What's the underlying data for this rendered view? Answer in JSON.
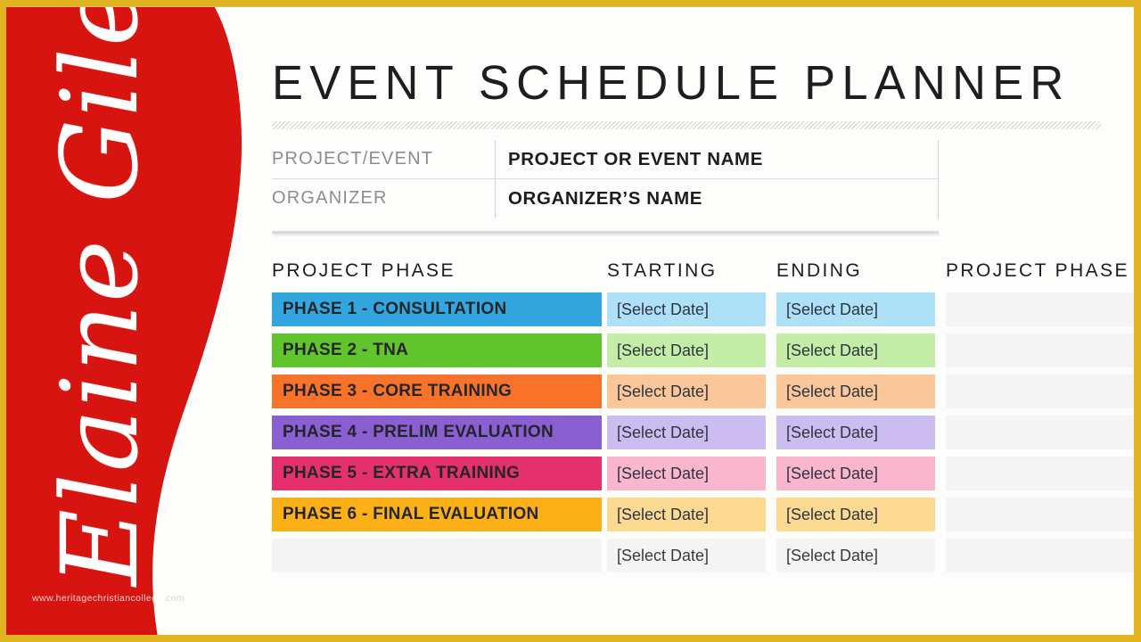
{
  "slide": {
    "title": "EVENT SCHEDULE PLANNER",
    "frame_color": "#e0b420",
    "background": "#fdfdfb"
  },
  "sidebar": {
    "shape_color": "#d81410",
    "signature": "Elaine Giles",
    "watermark": "www.heritagechristiancollege",
    "watermark_tail": ".com"
  },
  "info": {
    "rows": [
      {
        "label": "PROJECT/EVENT",
        "value": "PROJECT OR EVENT NAME"
      },
      {
        "label": "ORGANIZER",
        "value": "ORGANIZER’S NAME"
      }
    ]
  },
  "schedule": {
    "headers": [
      "PROJECT PHASE",
      "STARTING",
      "ENDING",
      "PROJECT PHASE"
    ],
    "date_placeholder": "[Select Date]",
    "rows": [
      {
        "phase": "PHASE 1 - CONSULTATION",
        "starting": "[Select Date]",
        "ending": "[Select Date]",
        "color": "#33a6e0",
        "tint": "#aee0f7"
      },
      {
        "phase": "PHASE 2 - TNA",
        "starting": "[Select Date]",
        "ending": "[Select Date]",
        "color": "#62c42d",
        "tint": "#c4eda8"
      },
      {
        "phase": "PHASE 3 - CORE TRAINING",
        "starting": "[Select Date]",
        "ending": "[Select Date]",
        "color": "#f8722a",
        "tint": "#fbc79a"
      },
      {
        "phase": "PHASE 4 - PRELIM EVALUATION",
        "starting": "[Select Date]",
        "ending": "[Select Date]",
        "color": "#8a5fd1",
        "tint": "#cbbdef"
      },
      {
        "phase": "PHASE 5 - EXTRA TRAINING",
        "starting": "[Select Date]",
        "ending": "[Select Date]",
        "color": "#e5306e",
        "tint": "#f9b6cd"
      },
      {
        "phase": "PHASE 6 - FINAL EVALUATION",
        "starting": "[Select Date]",
        "ending": "[Select Date]",
        "color": "#fbb018",
        "tint": "#fdda92"
      },
      {
        "phase": "",
        "starting": "[Select Date]",
        "ending": "[Select Date]",
        "color": "#f4f4f4",
        "tint": "#f4f4f4"
      }
    ]
  }
}
